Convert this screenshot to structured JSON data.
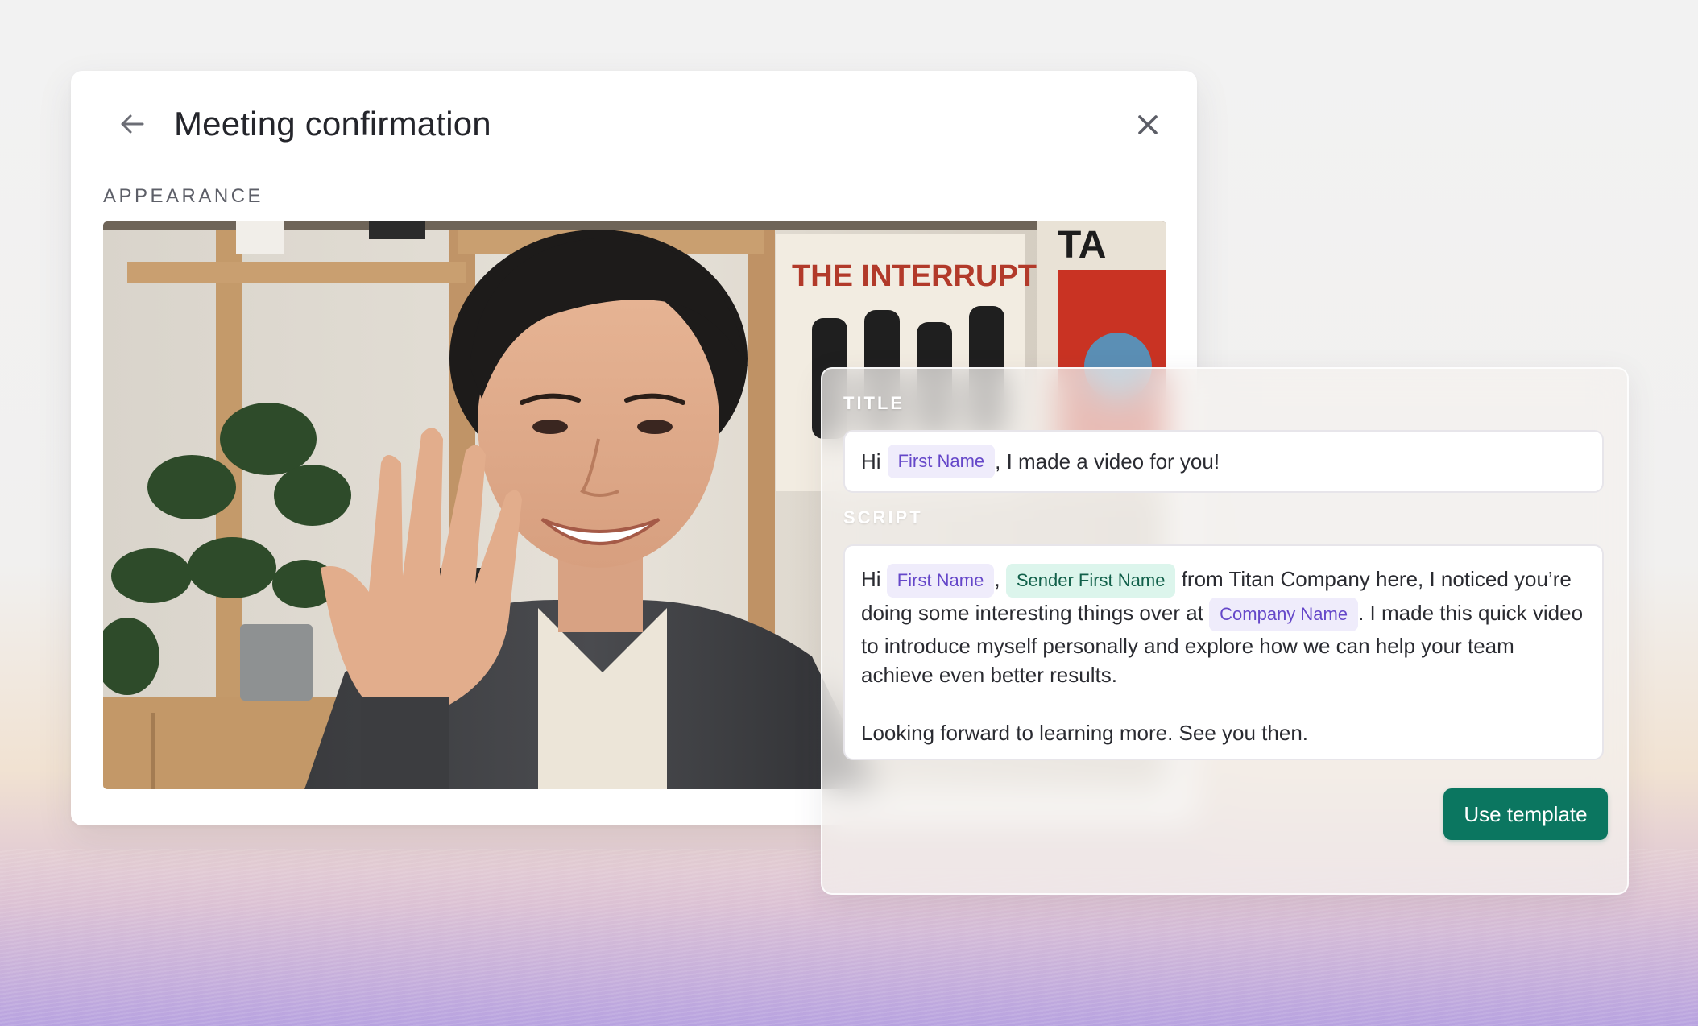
{
  "card": {
    "title": "Meeting confirmation",
    "appearance_label": "APPEARANCE"
  },
  "photo": {
    "poster_text": "THE INTERRUPTERS",
    "poster2_text": "TA"
  },
  "panel": {
    "title_label": "TITLE",
    "title_field": {
      "prefix": "Hi",
      "chip_first_name": "First Name",
      "suffix": ", I made a video for you!"
    },
    "script_label": "SCRIPT",
    "script": {
      "hi": "Hi",
      "chip_first_name": "First Name",
      "comma": ",",
      "chip_sender_first_name": "Sender First Name",
      "text_1": "from Titan Company here, I noticed you’re doing some interesting things over at",
      "chip_company_name": "Company Name",
      "text_2": ". I made this quick video to introduce myself personally and explore how we can help your team achieve even better results.",
      "closing": "Looking forward to learning more. See you then."
    },
    "cta_label": "Use template"
  },
  "colors": {
    "accent": "#0b7660",
    "chip_purple_bg": "#efecfb",
    "chip_purple_text": "#6547c9",
    "chip_green_bg": "#dcf5ec",
    "chip_green_text": "#11604a"
  },
  "icons": {
    "back": "arrow-left-icon",
    "close": "close-icon"
  }
}
